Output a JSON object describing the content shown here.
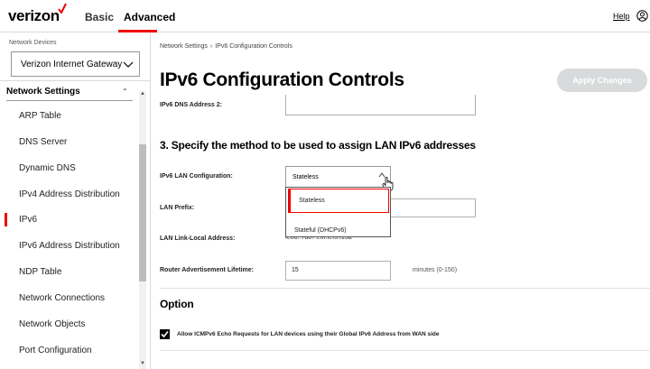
{
  "header": {
    "logo_text": "verizon",
    "tabs": [
      {
        "label": "Basic",
        "active": false
      },
      {
        "label": "Advanced",
        "active": true
      }
    ],
    "help_label": "Help",
    "accent_color": "#ee0000"
  },
  "sidebar": {
    "devices_label": "Network Devices",
    "device_selected": "Verizon Internet Gateway",
    "section_title": "Network Settings",
    "items": [
      {
        "label": "ARP Table",
        "active": false
      },
      {
        "label": "DNS Server",
        "active": false
      },
      {
        "label": "Dynamic DNS",
        "active": false
      },
      {
        "label": "IPv4 Address Distribution",
        "active": false
      },
      {
        "label": "IPv6",
        "active": true
      },
      {
        "label": "IPv6 Address Distribution",
        "active": false
      },
      {
        "label": "NDP Table",
        "active": false
      },
      {
        "label": "Network Connections",
        "active": false
      },
      {
        "label": "Network Objects",
        "active": false
      },
      {
        "label": "Port Configuration",
        "active": false
      }
    ]
  },
  "main": {
    "breadcrumb": [
      "Network Settings",
      "IPv6 Configuration Controls"
    ],
    "title": "IPv6 Configuration Controls",
    "apply_button": "Apply Changes",
    "dns2_label": "IPv6 DNS Address 2:",
    "dns2_value": "",
    "section3_title": "3. Specify the method to be used to assign LAN IPv6 addresses",
    "lan_config_label": "IPv6 LAN Configuration:",
    "lan_config_value": "Stateless",
    "lan_config_options": [
      "Stateless",
      "Stateful (DHCPv6)"
    ],
    "lan_prefix_label": "LAN Prefix:",
    "lan_prefix_value": "",
    "link_local_label": "LAN Link-Local Address:",
    "link_local_value": "fe80::7a67:efff:fef3:f15a",
    "router_adv_label": "Router Advertisement Lifetime:",
    "router_adv_value": "15",
    "router_adv_hint": "minutes (0-150)",
    "option_title": "Option",
    "icmp_checkbox_label": "Allow ICMPv6 Echo Requests for LAN devices using their Global IPv6 Address from WAN side",
    "icmp_checked": true
  }
}
